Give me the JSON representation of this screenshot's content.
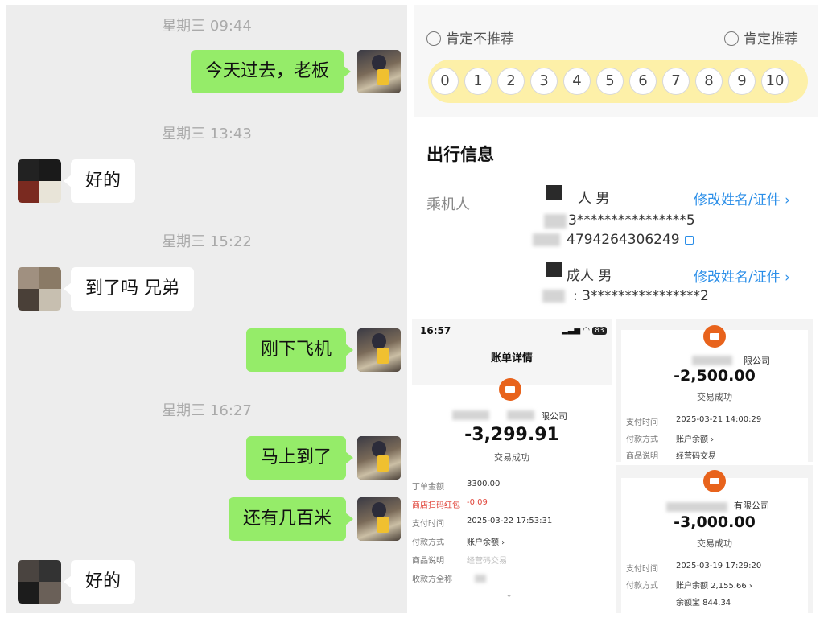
{
  "chat": {
    "messages": [
      {
        "type": "time",
        "text": "星期三 09:44"
      },
      {
        "type": "me",
        "text": "今天过去，老板"
      },
      {
        "type": "time",
        "text": "星期三 13:43"
      },
      {
        "type": "other",
        "text": "好的"
      },
      {
        "type": "time",
        "text": "星期三 15:22"
      },
      {
        "type": "other",
        "text": "到了吗 兄弟"
      },
      {
        "type": "me",
        "text": "刚下飞机"
      },
      {
        "type": "time",
        "text": "星期三 16:27"
      },
      {
        "type": "me",
        "text": "马上到了"
      },
      {
        "type": "me",
        "text": "还有几百米"
      },
      {
        "type": "other",
        "text": "好的"
      }
    ]
  },
  "rating": {
    "left_label": "肯定不推荐",
    "right_label": "肯定推荐",
    "scores": [
      "0",
      "1",
      "2",
      "3",
      "4",
      "5",
      "6",
      "7",
      "8",
      "9",
      "10"
    ],
    "icons": [
      "sad-face-icon",
      "happy-face-icon"
    ],
    "bar_color": "#fdf0a8"
  },
  "travel": {
    "title": "出行信息",
    "passenger_label": "乘机人",
    "p1_type": "人 男",
    "p1_id": "3****************5",
    "p1_ticket": "4794264306249",
    "p2_type": "成人 男",
    "p2_id": "3****************2",
    "edit_link": "修改姓名/证件",
    "link_color": "#2a8ee8"
  },
  "bill": {
    "time": "16:57",
    "battery": "83",
    "title": "账单详情",
    "merchant": "限公司",
    "amount": "-3,299.91",
    "status": "交易成功",
    "rows": [
      {
        "label": "丁单金额",
        "value": "3300.00"
      },
      {
        "label": "商店扫码红包",
        "value": "-0.09"
      },
      {
        "label": "支付时间",
        "value": "2025-03-22 17:53:31"
      },
      {
        "label": "付款方式",
        "value": "账户余额"
      },
      {
        "label": "商品说明",
        "value": "经营码交易"
      },
      {
        "label": "收款方全称",
        "value": ""
      }
    ]
  },
  "receipt2": {
    "merchant": "限公司",
    "amount": "-2,500.00",
    "status": "交易成功",
    "rows": [
      {
        "label": "支付时间",
        "value": "2025-03-21 14:00:29"
      },
      {
        "label": "付款方式",
        "value": "账户余额"
      },
      {
        "label": "商品说明",
        "value": "经营码交易"
      }
    ]
  },
  "receipt3": {
    "merchant": "有限公司",
    "amount": "-3,000.00",
    "status": "交易成功",
    "rows": [
      {
        "label": "支付时间",
        "value": "2025-03-19 17:29:20"
      },
      {
        "label": "付款方式",
        "value": "账户余额 2,155.66"
      },
      {
        "label": "",
        "value": "余额宝 844.34"
      }
    ]
  }
}
